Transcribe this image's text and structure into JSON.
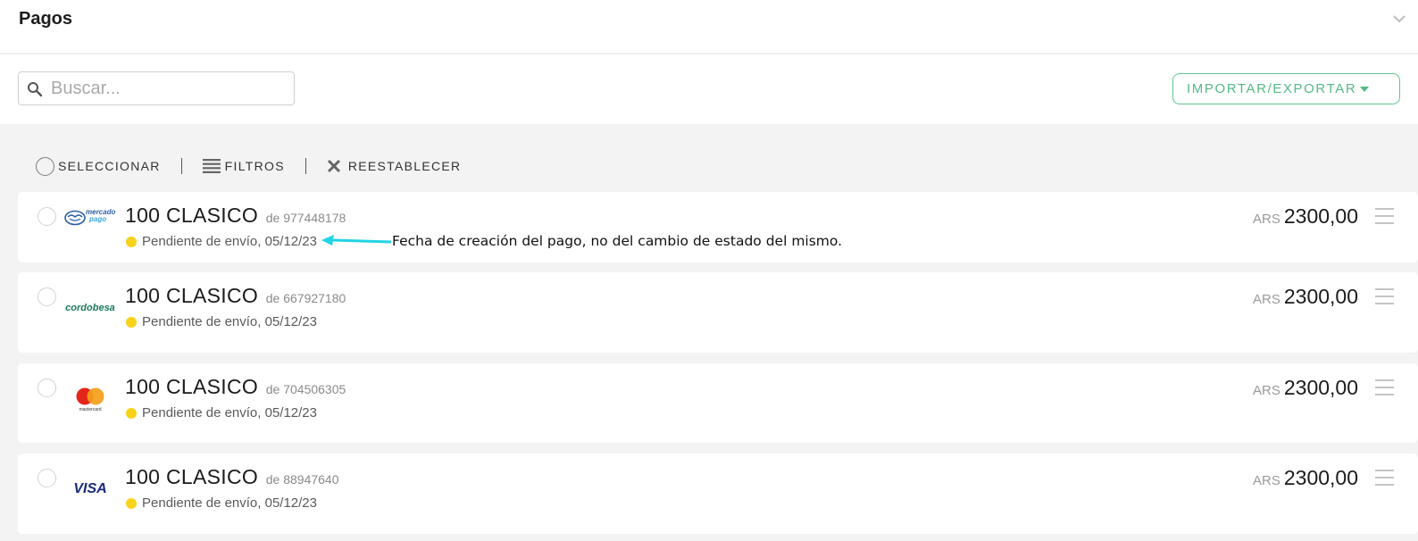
{
  "header": {
    "title": "Pagos",
    "collapse_icon": "chevron-down-icon"
  },
  "search": {
    "placeholder": "Buscar...",
    "value": "",
    "icon": "search-icon"
  },
  "import_export": {
    "label": "IMPORTAR/EXPORTAR"
  },
  "toolbar": {
    "select_label": "SELECCIONAR",
    "filters_label": "FILTROS",
    "reset_label": "REESTABLECER"
  },
  "colors": {
    "accent_green": "#55b985",
    "status_pending": "#f9d21a",
    "annotation_arrow": "#22d3e6"
  },
  "payments": [
    {
      "brand": "mercado pago",
      "brand_line1": "mercado",
      "brand_line2": "pago",
      "title": "100 CLASICO",
      "from": "de 977448178",
      "status": "Pendiente de envío, 05/12/23",
      "currency": "ARS",
      "amount": "2300,00"
    },
    {
      "brand": "cordobesa",
      "title": "100 CLASICO",
      "from": "de 667927180",
      "status": "Pendiente de envío, 05/12/23",
      "currency": "ARS",
      "amount": "2300,00"
    },
    {
      "brand": "mastercard",
      "title": "100 CLASICO",
      "from": "de 704506305",
      "status": "Pendiente de envío, 05/12/23",
      "currency": "ARS",
      "amount": "2300,00"
    },
    {
      "brand": "VISA",
      "title": "100 CLASICO",
      "from": "de 88947640",
      "status": "Pendiente de envío, 05/12/23",
      "currency": "ARS",
      "amount": "2300,00"
    }
  ],
  "annotation": {
    "text": "Fecha de creación del pago, no del cambio de estado del mismo."
  }
}
